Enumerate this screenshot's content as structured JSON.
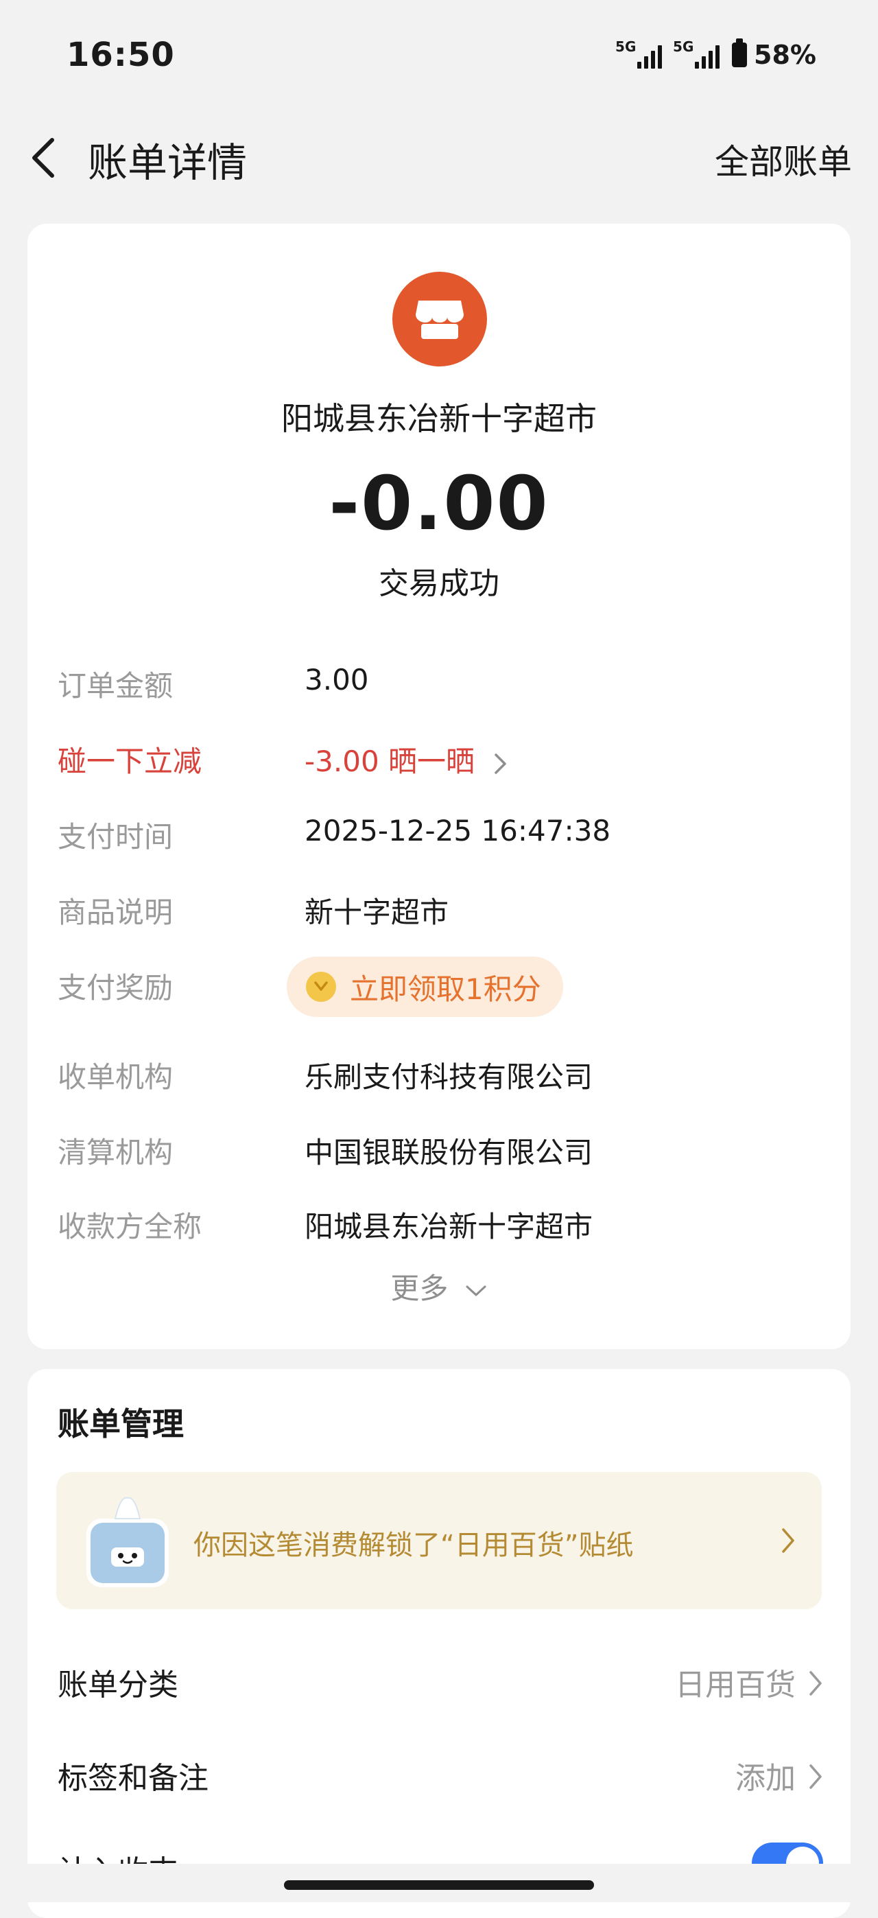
{
  "status_bar": {
    "time": "16:50",
    "signal1_label": "5G",
    "signal2_label": "5G",
    "battery": "58%"
  },
  "nav": {
    "title": "账单详情",
    "right_link": "全部账单"
  },
  "merchant": {
    "name": "阳城县东冶新十字超市",
    "icon": "store-icon",
    "brand_color": "#e2582c"
  },
  "amount": "-0.00",
  "status": "交易成功",
  "details": [
    {
      "label": "订单金额",
      "value": "3.00"
    },
    {
      "label": "碰一下立减",
      "value": "-3.00 晒一晒",
      "accent": "#d9423a"
    },
    {
      "label": "支付时间",
      "value": "2025-12-25 16:47:38"
    },
    {
      "label": "商品说明",
      "value": "新十字超市"
    },
    {
      "label": "支付奖励",
      "value": "立即领取1积分"
    },
    {
      "label": "收单机构",
      "value": "乐刷支付科技有限公司"
    },
    {
      "label": "清算机构",
      "value": "中国银联股份有限公司"
    },
    {
      "label": "收款方全称",
      "value": "阳城县东冶新十字超市"
    }
  ],
  "more_label": "更多",
  "manage": {
    "title": "账单管理",
    "sticker_text": "你因这笔消费解锁了“日用百货”贴纸",
    "category_label": "账单分类",
    "category_value": "日用百货",
    "tags_label": "标签和备注",
    "tags_value": "添加",
    "income_label": "计入收支",
    "income_enabled": true
  }
}
